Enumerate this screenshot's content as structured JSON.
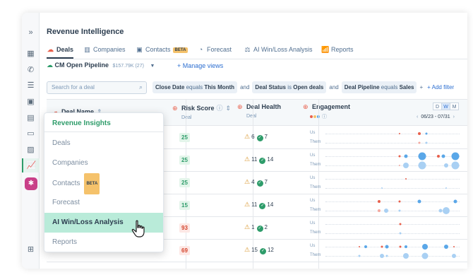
{
  "app_title": "Revenue Intelligence",
  "tabs": [
    {
      "label": "Deals",
      "icon": "deals-icon",
      "active": true
    },
    {
      "label": "Companies",
      "icon": "building-icon"
    },
    {
      "label": "Contacts",
      "icon": "contacts-icon",
      "badge": "BETA"
    },
    {
      "label": "Forecast",
      "icon": "forecast-icon"
    },
    {
      "label": "AI Win/Loss Analysis",
      "icon": "ai-analysis-icon"
    },
    {
      "label": "Reports",
      "icon": "reports-icon"
    }
  ],
  "pipeline": {
    "name": "CM Open Pipeline",
    "amount": "$157.79K (27)",
    "manage_label": "+ Manage views"
  },
  "search": {
    "placeholder": "Search for a deal"
  },
  "filters": [
    {
      "field": "Close Date",
      "op": "equals",
      "value": "This Month"
    },
    {
      "field": "Deal Status",
      "op": "is",
      "value": "Open deals"
    },
    {
      "field": "Deal Pipeline",
      "op": "equals",
      "value": "Sales"
    }
  ],
  "filter_conjunction": "and",
  "filter_plus": "+",
  "add_filter_label": "+ Add filter",
  "columns": {
    "deal_name": "Deal Name",
    "risk_score": "Risk Score",
    "risk_sub": "Deal",
    "deal_health": "Deal Health",
    "health_sub": "Deal",
    "engagement": "Engagement"
  },
  "period_toggle": [
    "D",
    "W",
    "M"
  ],
  "period_selected": "W",
  "date_range": "06/23 - 07/31",
  "row_labels": {
    "us": "Us",
    "them": "Them"
  },
  "rows": [
    {
      "risk": "25",
      "level": "low",
      "warn": "6",
      "ok": "7"
    },
    {
      "risk": "25",
      "level": "low",
      "warn": "11",
      "ok": "14"
    },
    {
      "risk": "25",
      "level": "low",
      "warn": "4",
      "ok": "7"
    },
    {
      "risk": "15",
      "level": "low",
      "warn": "11",
      "ok": "14"
    },
    {
      "risk": "93",
      "level": "high",
      "warn": "1",
      "ok": "2"
    },
    {
      "risk": "69",
      "level": "high",
      "warn": "15",
      "ok": "12"
    }
  ],
  "dropdown": {
    "heading": "Revenue Insights",
    "items": [
      "Deals",
      "Companies",
      "Contacts",
      "Forecast",
      "AI Win/Loss Analysis",
      "Reports"
    ],
    "contacts_badge": "BETA",
    "selected": "AI Win/Loss Analysis"
  },
  "colors": {
    "accent_green": "#2e9c6a",
    "link_blue": "#2d6fd1",
    "us_red": "#e8604c",
    "them_blue": "#5aa7e8",
    "menu_highlight": "#b9ebd9"
  }
}
